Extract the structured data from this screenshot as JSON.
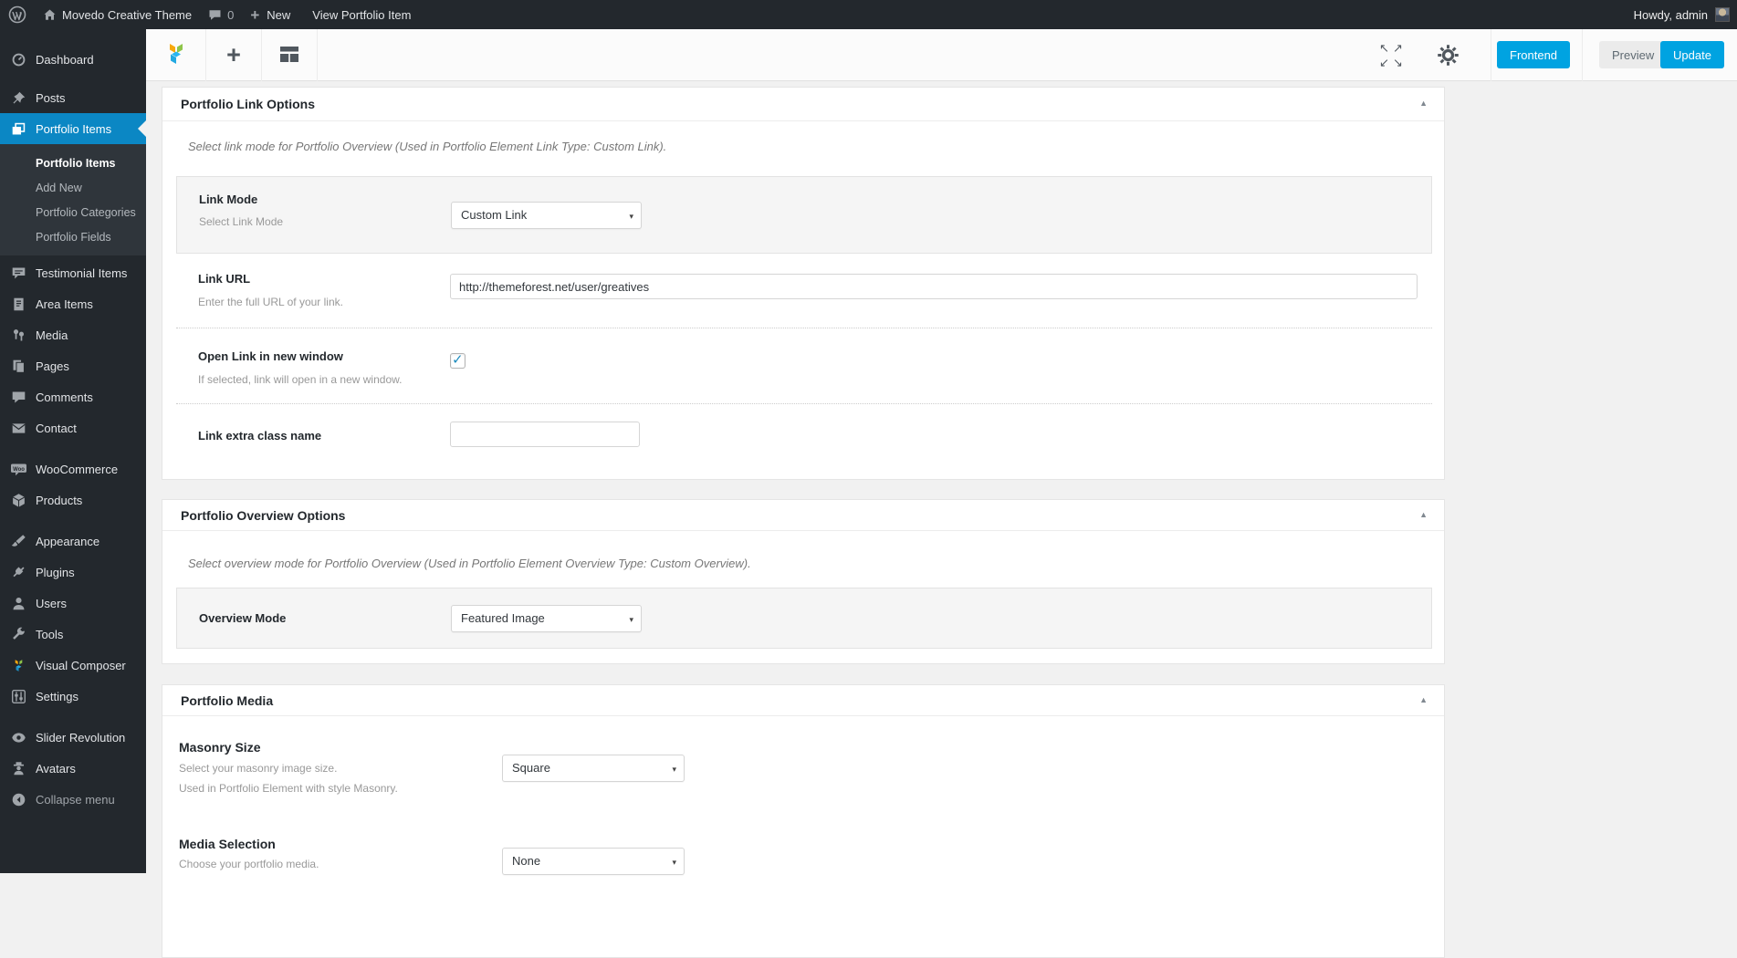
{
  "admin_bar": {
    "site_name": "Movedo Creative Theme",
    "comment_count": "0",
    "new_label": "New",
    "view_item_label": "View Portfolio Item",
    "howdy": "Howdy, admin"
  },
  "sidebar": {
    "items": [
      {
        "label": "Dashboard"
      },
      {
        "label": "Posts"
      },
      {
        "label": "Portfolio Items",
        "active": true
      },
      {
        "label": "Testimonial Items"
      },
      {
        "label": "Area Items"
      },
      {
        "label": "Media"
      },
      {
        "label": "Pages"
      },
      {
        "label": "Comments"
      },
      {
        "label": "Contact"
      },
      {
        "label": "WooCommerce"
      },
      {
        "label": "Products"
      },
      {
        "label": "Appearance"
      },
      {
        "label": "Plugins"
      },
      {
        "label": "Users"
      },
      {
        "label": "Tools"
      },
      {
        "label": "Visual Composer"
      },
      {
        "label": "Settings"
      },
      {
        "label": "Slider Revolution"
      },
      {
        "label": "Avatars"
      },
      {
        "label": "Collapse menu"
      }
    ],
    "portfolio_submenu": [
      {
        "label": "Portfolio Items",
        "current": true
      },
      {
        "label": "Add New"
      },
      {
        "label": "Portfolio Categories"
      },
      {
        "label": "Portfolio Fields"
      }
    ]
  },
  "toolbar": {
    "frontend_label": "Frontend",
    "preview_label": "Preview",
    "update_label": "Update"
  },
  "link_options": {
    "title": "Portfolio Link Options",
    "description": "Select link mode for Portfolio Overview (Used in Portfolio Element Link Type: Custom Link).",
    "link_mode": {
      "label": "Link Mode",
      "hint": "Select Link Mode",
      "value": "Custom Link"
    },
    "link_url": {
      "label": "Link URL",
      "hint": "Enter the full URL of your link.",
      "value": "http://themeforest.net/user/greatives"
    },
    "open_new_window": {
      "label": "Open Link in new window",
      "hint": "If selected, link will open in a new window.",
      "checked": true
    },
    "extra_class": {
      "label": "Link extra class name",
      "value": ""
    }
  },
  "overview_options": {
    "title": "Portfolio Overview Options",
    "description": "Select overview mode for Portfolio Overview (Used in Portfolio Element Overview Type: Custom Overview).",
    "overview_mode": {
      "label": "Overview Mode",
      "value": "Featured Image"
    }
  },
  "portfolio_media": {
    "title": "Portfolio Media",
    "masonry_size": {
      "label": "Masonry Size",
      "hint": "Select your masonry image size.",
      "hint2": "Used in Portfolio Element with style Masonry.",
      "value": "Square"
    },
    "media_selection": {
      "label": "Media Selection",
      "hint": "Choose your portfolio media.",
      "value": "None"
    }
  },
  "icons": {
    "dropdown_arrow": "▾",
    "collapse_arrow": "▲",
    "checkmark": "✓",
    "plus": "+",
    "expand_tl": "↖",
    "expand_tr": "↗",
    "expand_bl": "↙",
    "expand_br": "↘"
  }
}
